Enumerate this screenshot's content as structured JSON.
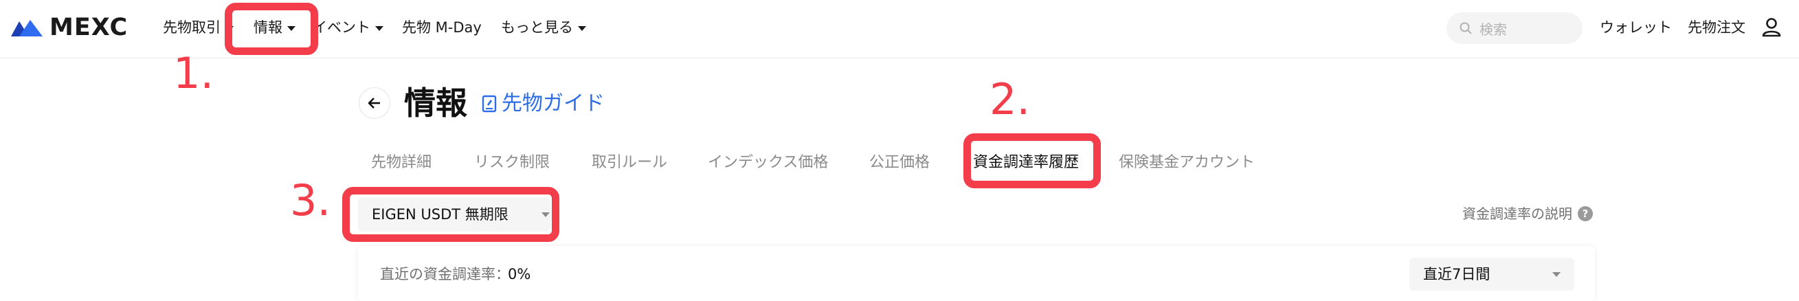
{
  "brand": {
    "name": "MEXC"
  },
  "nav": {
    "items": [
      {
        "label": "先物取引"
      },
      {
        "label": "情報"
      },
      {
        "label": "イベント"
      },
      {
        "label": "先物 M-Day"
      },
      {
        "label": "もっと見る"
      }
    ],
    "search_placeholder": "検索",
    "wallet": "ウォレット",
    "futures_orders": "先物注文"
  },
  "annotations": {
    "step1": "1.",
    "step2": "2.",
    "step3": "3.",
    "color": "#f33d4b"
  },
  "page": {
    "title": "情報",
    "guide_link": "先物ガイド"
  },
  "tabs": [
    {
      "label": "先物詳細"
    },
    {
      "label": "リスク制限"
    },
    {
      "label": "取引ルール"
    },
    {
      "label": "インデックス価格"
    },
    {
      "label": "公正価格"
    },
    {
      "label": "資金調達率履歴",
      "active": true
    },
    {
      "label": "保険基金アカウント"
    }
  ],
  "contract_select": {
    "value": "EIGEN USDT 無期限"
  },
  "explain_link": "資金調達率の説明",
  "funding": {
    "label": "直近の資金調達率：",
    "value": "0%",
    "period": "直近7日間"
  },
  "colors": {
    "accent_link": "#2d6ee8",
    "brand": "#2354e6"
  }
}
